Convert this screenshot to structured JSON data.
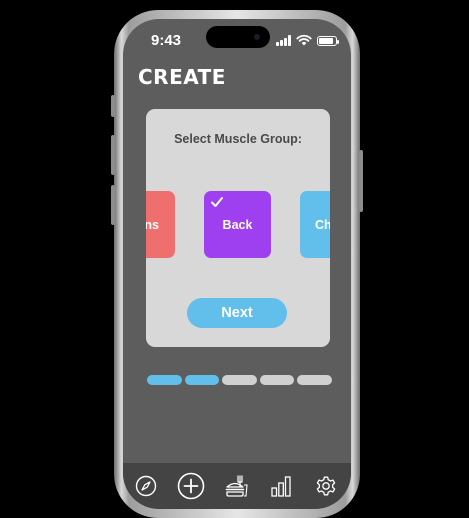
{
  "status_bar": {
    "time": "9:43",
    "battery_level": 0.9
  },
  "header": {
    "title": "CREATE"
  },
  "modal": {
    "title": "Select Muscle Group:",
    "muscle_groups": [
      {
        "label": "ns",
        "color": "#ef6f6f",
        "selected": false
      },
      {
        "label": "Back",
        "color": "#9e3ff0",
        "selected": true
      },
      {
        "label": "Ch",
        "color": "#62bfec",
        "selected": false
      }
    ],
    "next_label": "Next"
  },
  "progress": {
    "total_steps": 5,
    "completed_steps": 2,
    "active_color": "#62bfec",
    "inactive_color": "#d0d0d0"
  },
  "tab_bar": {
    "items": [
      {
        "icon": "compass-icon"
      },
      {
        "icon": "add-circle-icon"
      },
      {
        "icon": "meal-icon"
      },
      {
        "icon": "bar-chart-icon"
      },
      {
        "icon": "gear-icon"
      }
    ]
  },
  "colors": {
    "screen_background": "#5d5d5d",
    "modal_background": "#d8d8d8",
    "tab_bar_background": "#444444"
  }
}
